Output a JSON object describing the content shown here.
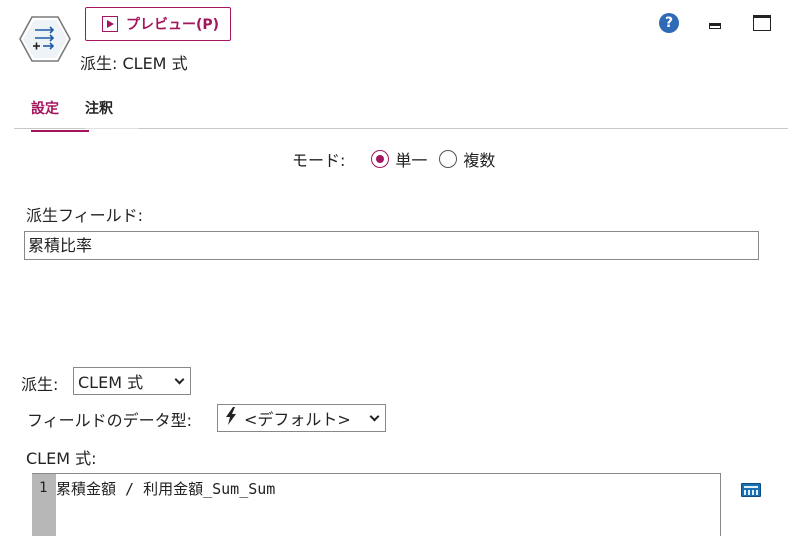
{
  "header": {
    "preview_label": "プレビュー(P)",
    "node_title": "派生: CLEM 式"
  },
  "window": {
    "help_symbol": "?"
  },
  "tabs": [
    {
      "label": "設定",
      "active": true
    },
    {
      "label": "注釈",
      "active": false
    }
  ],
  "mode": {
    "label": "モード:",
    "options": [
      {
        "label": "単一",
        "selected": true
      },
      {
        "label": "複数",
        "selected": false
      }
    ]
  },
  "derive_field": {
    "label": "派生フィールド:",
    "value": "累積比率"
  },
  "derive_as": {
    "label": "派生:",
    "value": "CLEM 式"
  },
  "field_type": {
    "label": "フィールドのデータ型:",
    "value": "<デフォルト>"
  },
  "expression": {
    "label": "CLEM 式:",
    "line_number": "1",
    "code": "累積金額 / 利用金額_Sum_Sum"
  },
  "icons": {
    "node": "derive-node-icon",
    "preview": "play-icon",
    "help": "help-icon",
    "minimize": "minimize-icon",
    "maximize": "maximize-icon",
    "type": "lightning-bolt-icon",
    "expression_builder": "calculator-icon"
  },
  "colors": {
    "accent": "#a3165d",
    "help": "#2f6ab7",
    "gutter": "#b7b7b7"
  }
}
